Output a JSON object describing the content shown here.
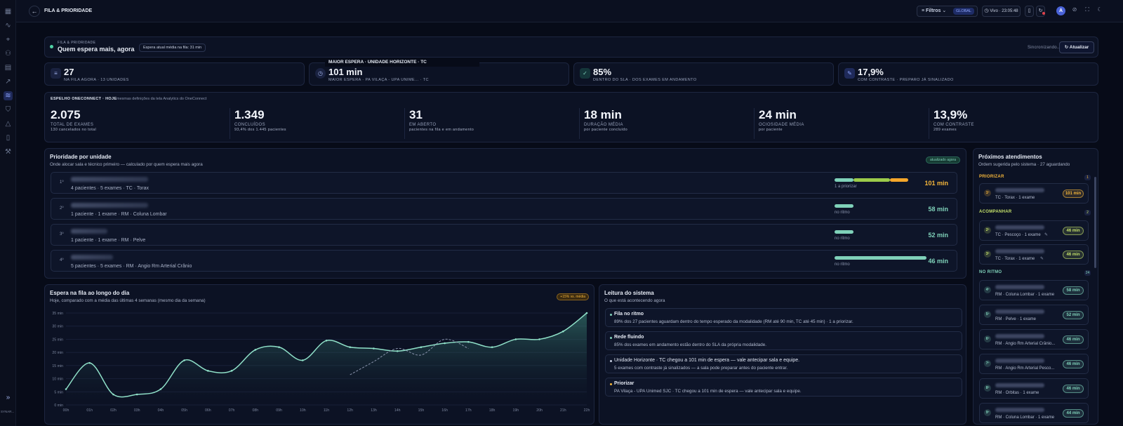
{
  "topbar": {
    "title": "FILA & PRIORIDADE",
    "filters_label": "Filtros",
    "scope_badge": "GLOBAL",
    "live_label": "Vivo · 23:05:48",
    "avatar_initial": "A"
  },
  "header": {
    "kicker": "FILA & PRIORIDADE",
    "title": "Quem espera mais, agora",
    "avg_pill": "Espera atual média na fila: 31 min",
    "sync_label": "Sincronizando...",
    "refresh_label": "Atualizar"
  },
  "kpis": [
    {
      "icon": "list-icon",
      "value": "27",
      "label": "NA FILA AGORA · 13 UNIDADES"
    },
    {
      "icon": "clock-icon",
      "value": "101 min",
      "label": "MAIOR ESPERA · PA VILAÇA - UPA UNIME... · TC",
      "tooltip": "MAIOR ESPERA · UNIDADE HORIZONTE · TC"
    },
    {
      "icon": "check-icon",
      "value": "85%",
      "label": "DENTRO DO SLA · DOS EXAMES EM ANDAMENTO"
    },
    {
      "icon": "syringe-icon",
      "value": "17,9%",
      "label": "COM CONTRASTE · PREPARO JÁ SINALIZADO"
    }
  ],
  "mirror": {
    "title": "ESPELHO ONECONNECT · HOJE",
    "subtitle": "mesmas definições da tela Analytics do OneConnect",
    "stats": [
      {
        "value": "2.075",
        "label": "TOTAL DE EXAMES",
        "sub": "130 cancelados no total"
      },
      {
        "value": "1.349",
        "label": "CONCLUÍDOS",
        "sub": "93,4% dos 1.445 pacientes"
      },
      {
        "value": "31",
        "label": "EM ABERTO",
        "sub": "pacientes na fila e em andamento"
      },
      {
        "value": "18 min",
        "label": "DURAÇÃO MÉDIA",
        "sub": "por paciente concluído"
      },
      {
        "value": "24 min",
        "label": "OCIOSIDADE MÉDIA",
        "sub": "por paciente"
      },
      {
        "value": "13,9%",
        "label": "COM CONTRASTE",
        "sub": "289 exames"
      }
    ]
  },
  "priority": {
    "title": "Prioridade por unidade",
    "subtitle": "Onde alocar sala e técnico primeiro — calculado por quem espera mais agora",
    "badge": "atualizado agora",
    "rows": [
      {
        "rank": "1º",
        "sub": "4 pacientes · 5 exames · TC · Torax",
        "status": "1 a priorizar",
        "minutes": "101 min",
        "color": "#f5b63a"
      },
      {
        "rank": "2º",
        "sub": "1 paciente · 1 exame · RM · Coluna Lombar",
        "status": "no ritmo",
        "minutes": "58 min",
        "color": "#7fd1b9"
      },
      {
        "rank": "3º",
        "sub": "1 paciente · 1 exame · RM · Pelve",
        "status": "no ritmo",
        "minutes": "52 min",
        "color": "#7fd1b9"
      },
      {
        "rank": "4º",
        "sub": "5 pacientes · 5 exames · RM · Angio Rm Arterial Crânio",
        "status": "no ritmo",
        "minutes": "46 min",
        "color": "#7fd1b9"
      }
    ]
  },
  "wait_chart": {
    "title": "Espera na fila ao longo do dia",
    "subtitle": "Hoje, comparado com a média das últimas 4 semanas (mesmo dia da semana)",
    "badge": "+15% vs. média"
  },
  "chart_data": {
    "type": "area",
    "ylim": [
      0,
      35
    ],
    "yticks": [
      "0 min",
      "5 min",
      "10 min",
      "15 min",
      "20 min",
      "25 min",
      "30 min",
      "35 min"
    ],
    "x": [
      "00h",
      "01h",
      "02h",
      "03h",
      "04h",
      "05h",
      "06h",
      "07h",
      "08h",
      "09h",
      "10h",
      "11h",
      "12h",
      "13h",
      "14h",
      "15h",
      "16h",
      "17h",
      "18h",
      "19h",
      "20h",
      "21h",
      "22h"
    ],
    "series": [
      {
        "name": "",
        "values": [
          6,
          16,
          4,
          4,
          6,
          17,
          13,
          13,
          21,
          22,
          17,
          24.5,
          22,
          21.5,
          20.5,
          22,
          23.5,
          24,
          22,
          25,
          25,
          28,
          35
        ]
      },
      {
        "name": "",
        "dashed": true,
        "values": [
          null,
          null,
          null,
          null,
          null,
          null,
          null,
          null,
          null,
          null,
          null,
          null,
          11.5,
          16.5,
          21.5,
          19,
          25,
          21.5,
          null,
          null,
          null,
          null,
          null
        ]
      }
    ]
  },
  "reading": {
    "title": "Leitura do sistema",
    "subtitle": "O que está acontecendo agora",
    "items": [
      {
        "title": "Fila no ritmo",
        "body": "89% dos 27 pacientes aguardam dentro do tempo esperado da modalidade (RM até 90 min, TC até 45 min) · 1 a priorizar.",
        "dot": "#7fd1b9"
      },
      {
        "title": "Rede fluindo",
        "body": "85% dos exames em andamento estão dentro do SLA da própria modalidade.",
        "dot": "#7fd1b9"
      },
      {
        "title": "Unidade Horizonte · TC chegou a 101 min de espera — vale antecipar sala e equipe.",
        "body": "5 exames com contraste já sinalizados — a sala pode preparar antes do paciente entrar.",
        "dot": "#c6cde0"
      },
      {
        "title": "Priorizar",
        "body": "PA Vilaça - UPA Unimed SJC · TC chegou a 101 min de espera — vale antecipar sala e equipe.",
        "dot": "#f5b63a"
      }
    ]
  },
  "queue": {
    "title": "Próximos atendimentos",
    "subtitle": "Ordem sugerida pelo sistema · 27 aguardando",
    "sections": [
      {
        "label": "PRIORIZAR",
        "count": "1",
        "color": "#f5b63a"
      },
      {
        "label": "ACOMPANHAR",
        "count": "2",
        "color": "#c3e06a"
      },
      {
        "label": "NO RITMO",
        "count": "24",
        "color": "#7fd1b9"
      }
    ],
    "items": [
      {
        "rank": "1º",
        "sub": "TC · Torax · 1 exame",
        "minutes": "101 min",
        "color": "#f5b63a"
      },
      {
        "rank": "2º",
        "sub": "TC · Pescoço · 1 exame",
        "minutes": "46 min",
        "color": "#c3e06a"
      },
      {
        "rank": "3º",
        "sub": "TC · Torax · 1 exame",
        "minutes": "46 min",
        "color": "#c3e06a"
      },
      {
        "rank": "4º",
        "sub": "RM · Coluna Lombar · 1 exame",
        "minutes": "58 min",
        "color": "#7fd1b9"
      },
      {
        "rank": "5º",
        "sub": "RM · Pelve · 1 exame",
        "minutes": "52 min",
        "color": "#7fd1b9"
      },
      {
        "rank": "6º",
        "sub": "RM · Angio Rm Arterial Crânio...",
        "minutes": "46 min",
        "color": "#7fd1b9"
      },
      {
        "rank": "7º",
        "sub": "RM · Angio Rm Arterial Pesco...",
        "minutes": "46 min",
        "color": "#7fd1b9"
      },
      {
        "rank": "8º",
        "sub": "RM · Orbitas · 1 exame",
        "minutes": "46 min",
        "color": "#7fd1b9"
      },
      {
        "rank": "9º",
        "sub": "RM · Coluna Lombar · 1 exame",
        "minutes": "44 min",
        "color": "#7fd1b9"
      }
    ]
  },
  "rail": {
    "footer": "SYNAR..."
  }
}
